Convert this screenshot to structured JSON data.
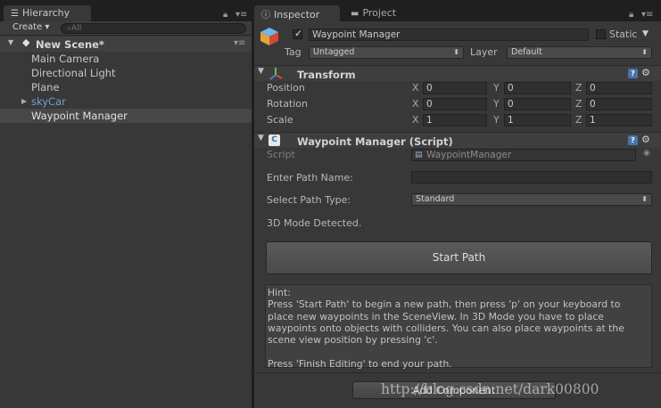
{
  "hierarchy": {
    "tab_label": "Hierarchy",
    "create_label": "Create ▾",
    "search_placeholder": "⌕All",
    "scene_name": "New Scene*",
    "items": [
      {
        "label": "Main Camera",
        "prefab": false,
        "selected": false,
        "expandable": false
      },
      {
        "label": "Directional Light",
        "prefab": false,
        "selected": false,
        "expandable": false
      },
      {
        "label": "Plane",
        "prefab": false,
        "selected": false,
        "expandable": false
      },
      {
        "label": "skyCar",
        "prefab": true,
        "selected": false,
        "expandable": true
      },
      {
        "label": "Waypoint Manager",
        "prefab": false,
        "selected": true,
        "expandable": false
      }
    ]
  },
  "inspector": {
    "tab_label": "Inspector",
    "project_tab_label": "Project",
    "object": {
      "active": true,
      "name": "Waypoint Manager",
      "static_label": "Static",
      "static_checked": false,
      "tag_label": "Tag",
      "tag_value": "Untagged",
      "layer_label": "Layer",
      "layer_value": "Default"
    },
    "transform": {
      "title": "Transform",
      "rows": [
        {
          "label": "Position",
          "x": "0",
          "y": "0",
          "z": "0"
        },
        {
          "label": "Rotation",
          "x": "0",
          "y": "0",
          "z": "0"
        },
        {
          "label": "Scale",
          "x": "1",
          "y": "1",
          "z": "1"
        }
      ],
      "axis_x": "X",
      "axis_y": "Y",
      "axis_z": "Z"
    },
    "waypoint_script": {
      "title": "Waypoint Manager (Script)",
      "script_label": "Script",
      "script_value": "WaypointManager",
      "enter_path_label": "Enter Path Name:",
      "enter_path_value": "",
      "path_type_label": "Select Path Type:",
      "path_type_value": "Standard",
      "mode_text": "3D Mode Detected.",
      "start_button": "Start Path",
      "hint_text": "Hint:\nPress 'Start Path' to begin a new path, then press 'p' on your keyboard to\nplace new waypoints in the SceneView. In 3D Mode you have to place\nwaypoints onto objects with colliders. You can also place waypoints at the\nscene view position by pressing 'c'.\n\nPress 'Finish Editing' to end your path."
    },
    "add_component_label": "Add Component",
    "watermark": "http://blog.csdn.net/dark00800"
  },
  "colors": {
    "panel_bg": "#383838",
    "dark_bg": "#222222",
    "selected_row": "#474747",
    "prefab_blue": "#6f9fd8",
    "text": "#bdbdbd"
  }
}
